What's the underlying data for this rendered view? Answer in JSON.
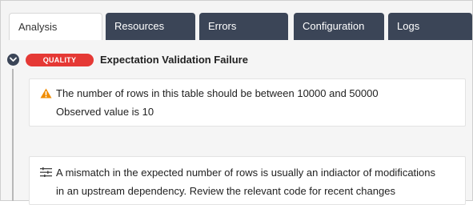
{
  "tabs": [
    {
      "label": "Analysis",
      "active": true
    },
    {
      "label": "Resources",
      "active": false
    },
    {
      "label": "Errors",
      "active": false
    },
    {
      "label": "Configuration",
      "active": false
    },
    {
      "label": "Logs",
      "active": false
    }
  ],
  "event": {
    "badge": "QUALITY",
    "title": "Expectation Validation Failure",
    "warning": {
      "icon": "warning-icon",
      "line1": "The number of rows in this table should be between 10000 and 50000",
      "line2": "Observed value is 10"
    },
    "hint": {
      "icon": "tune-icon",
      "line1": "A mismatch in the expected number of rows is usually an indiactor of modifications",
      "line2": "in an upstream dependency. Review the relevant code for recent changes"
    }
  },
  "colors": {
    "tab_dark": "#3b4557",
    "badge_red": "#e53935",
    "warning_orange": "#f08c00"
  }
}
